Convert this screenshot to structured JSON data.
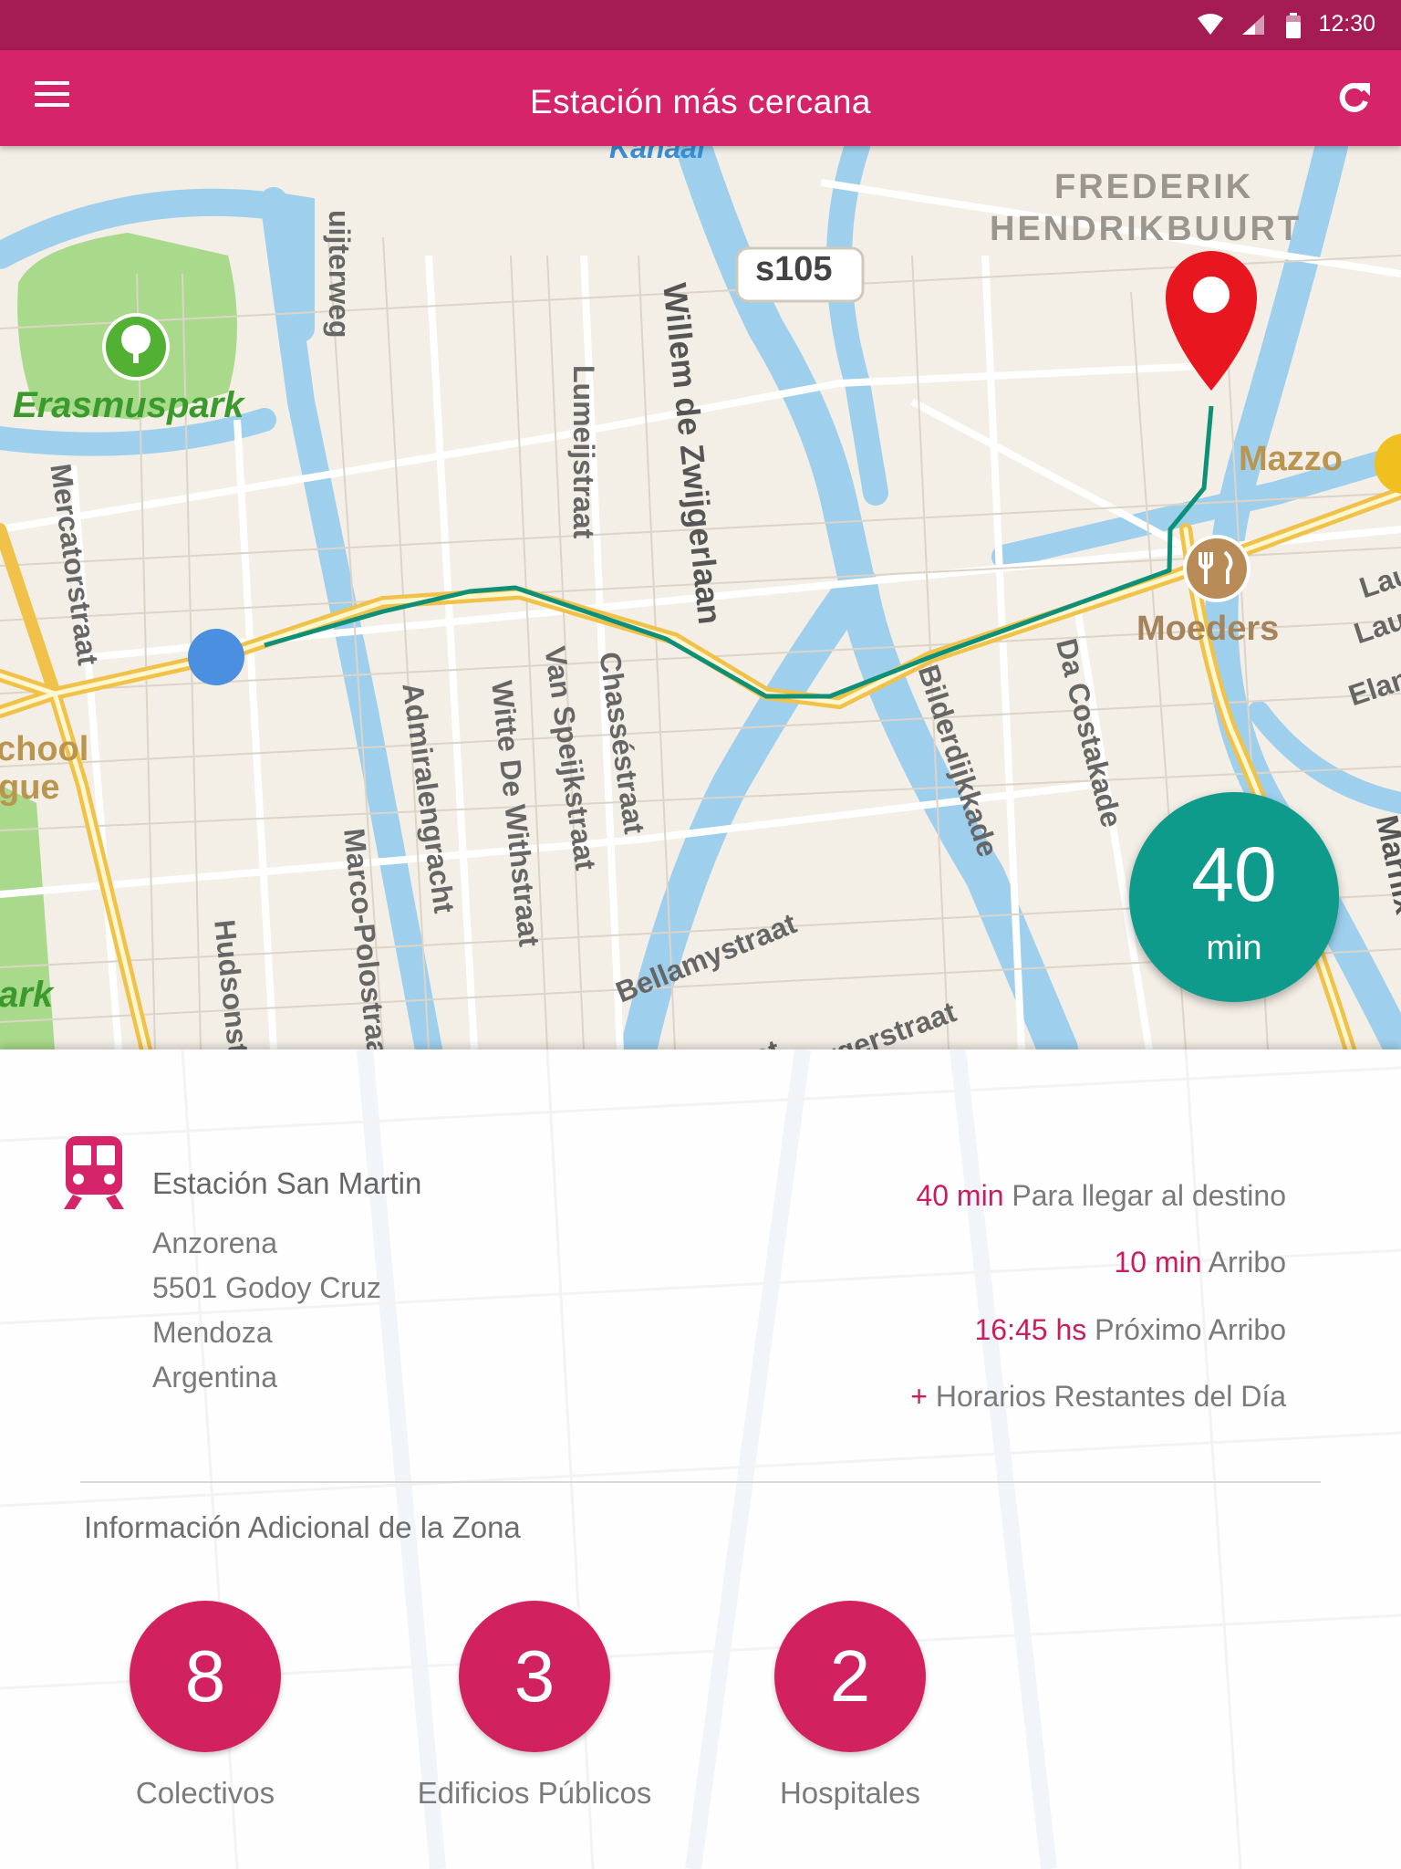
{
  "status_bar": {
    "time": "12:30"
  },
  "app_bar": {
    "title": "Estación más cercana"
  },
  "map": {
    "labels": {
      "kanaal": "Kanaal",
      "frederik": "FREDERIK",
      "hendrikbuurt": "HENDRIKBUURT",
      "s105": "s105",
      "erasmuspark": "Erasmuspark",
      "mazzo": "Mazzo",
      "moeders": "Moeders",
      "bilderdijkkade": "Bilderdijkkade",
      "lumeijstraat": "Lumeijstraat",
      "willem": "Willem de Zwijgerlaan",
      "mercatorstraat": "Mercatorstraat",
      "admiralengracht": "Admiralengracht",
      "witte": "Witte De Withstraat",
      "vanspeijk": "Van Speijkstraat",
      "chasse": "Chasséstraat",
      "dacostakade": "Da Costakade",
      "bellamystraat": "Bellamystraat",
      "marcopolo": "Marco-Polostraat",
      "hudson": "Hudsonstraat",
      "kinkerstraat": "Kinkerstraat",
      "borgerstraat": "Borgerstraat",
      "school": "chool",
      "gue": "gue",
      "ark": "ark",
      "uijterweg": "uijterweg",
      "lau1": "Lau",
      "lau2": "Lau",
      "elan": "Elan",
      "marnix": "Marnix"
    }
  },
  "duration": {
    "value": "40",
    "unit": "min"
  },
  "station": {
    "name": "Estación San Martin",
    "address": [
      "Anzorena",
      "5501 Godoy Cruz",
      "Mendoza",
      "Argentina"
    ]
  },
  "schedule": {
    "to_destination": {
      "value": "40 min",
      "label": "Para llegar al destino"
    },
    "arrival": {
      "value": "10 min",
      "label": "Arribo"
    },
    "next_arrival": {
      "value": "16:45 hs",
      "label": "Próximo Arribo"
    },
    "more": {
      "prefix": "+",
      "label": "Horarios Restantes del Día"
    }
  },
  "zone": {
    "title": "Información Adicional de la Zona",
    "stats": [
      {
        "count": "8",
        "label": "Colectivos"
      },
      {
        "count": "3",
        "label": "Edificios Públicos"
      },
      {
        "count": "2",
        "label": "Hospitales"
      }
    ]
  },
  "colors": {
    "primary": "#d6246a",
    "status_bar": "#a51c55",
    "accent_teal": "#0f9b8c",
    "highlight": "#c81e5f",
    "route": "#0e8f78",
    "marker": "#e8171f"
  }
}
